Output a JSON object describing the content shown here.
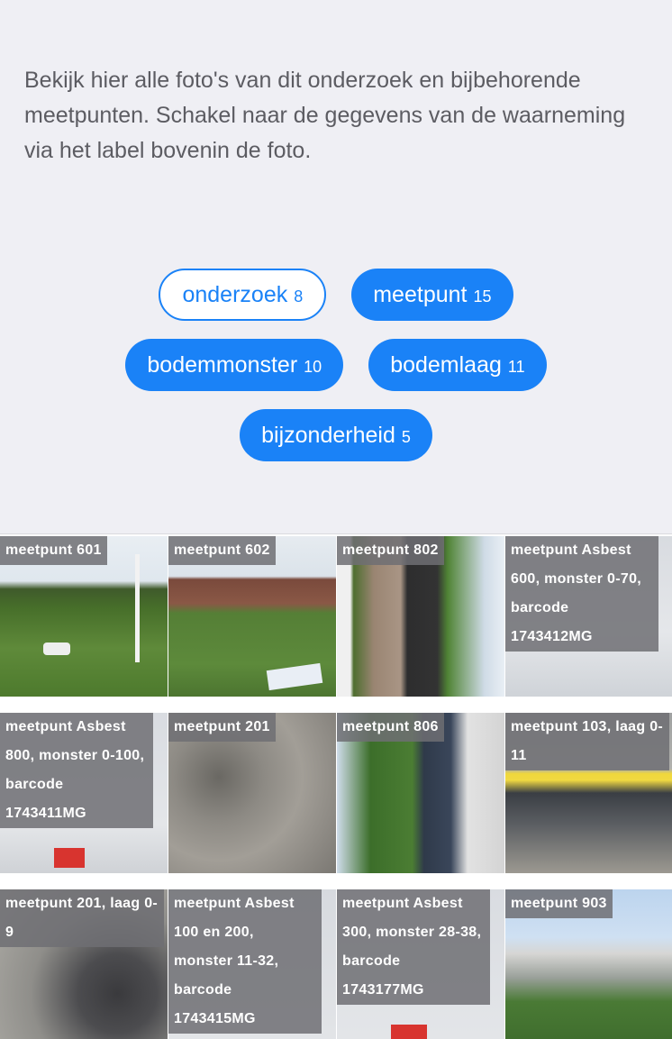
{
  "intro": "Bekijk hier alle foto's van dit onderzoek en bijbehorende meetpunten. Schakel naar de gegevens van de waarneming via het label bovenin de foto.",
  "filters": [
    {
      "label": "onderzoek",
      "count": "8",
      "selected": false
    },
    {
      "label": "meetpunt",
      "count": "15",
      "selected": true
    },
    {
      "label": "bodemmonster",
      "count": "10",
      "selected": true
    },
    {
      "label": "bodemlaag",
      "count": "11",
      "selected": true
    },
    {
      "label": "bijzonderheid",
      "count": "5",
      "selected": true
    }
  ],
  "photos": [
    {
      "label": "meetpunt 601"
    },
    {
      "label": "meetpunt 602"
    },
    {
      "label": "meetpunt 802"
    },
    {
      "label": "meetpunt Asbest 600, monster 0-70, barcode 1743412MG"
    },
    {
      "label": "meetpunt Asbest 800, monster 0-100, barcode 1743411MG"
    },
    {
      "label": "meetpunt 201"
    },
    {
      "label": "meetpunt 806"
    },
    {
      "label": "meetpunt 103, laag 0-11"
    },
    {
      "label": "meetpunt 201, laag 0-9"
    },
    {
      "label": "meetpunt Asbest 100 en 200, monster 11-32, barcode 1743415MG"
    },
    {
      "label": "meetpunt Asbest 300, monster 28-38, barcode 1743177MG"
    },
    {
      "label": "meetpunt 903"
    }
  ],
  "colors": {
    "accent": "#1a82f7",
    "background": "#efeff4"
  }
}
